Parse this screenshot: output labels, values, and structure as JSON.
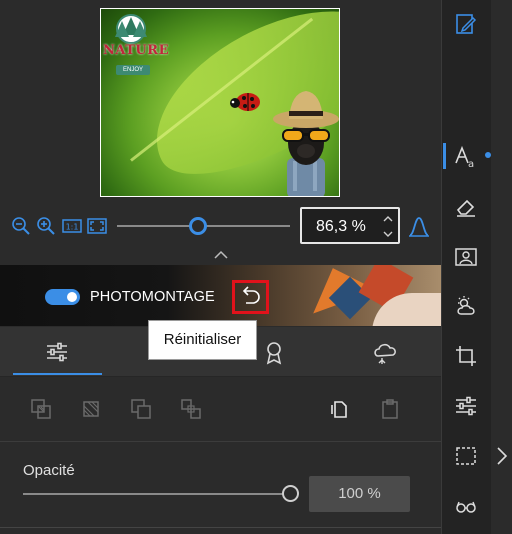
{
  "preview": {
    "logo_text": "NATURE",
    "logo_subtext": "ENJOY"
  },
  "zoom": {
    "value": "86,3 %"
  },
  "banner": {
    "title": "PHOTOMONTAGE",
    "toggle_on": true
  },
  "tooltip": {
    "text": "Réinitialiser"
  },
  "tabs": [
    {
      "icon": "sliders-icon",
      "active": true
    },
    {
      "icon": "layers-icon",
      "active": false
    },
    {
      "icon": "badge-icon",
      "active": false
    },
    {
      "icon": "effects-icon",
      "active": false
    }
  ],
  "opacity": {
    "label": "Opacité",
    "value": "100 %",
    "level": 1.0
  },
  "colors": {
    "accent": "#3b8ee6",
    "highlight": "#e1121b",
    "panel": "#2b2b2b"
  }
}
